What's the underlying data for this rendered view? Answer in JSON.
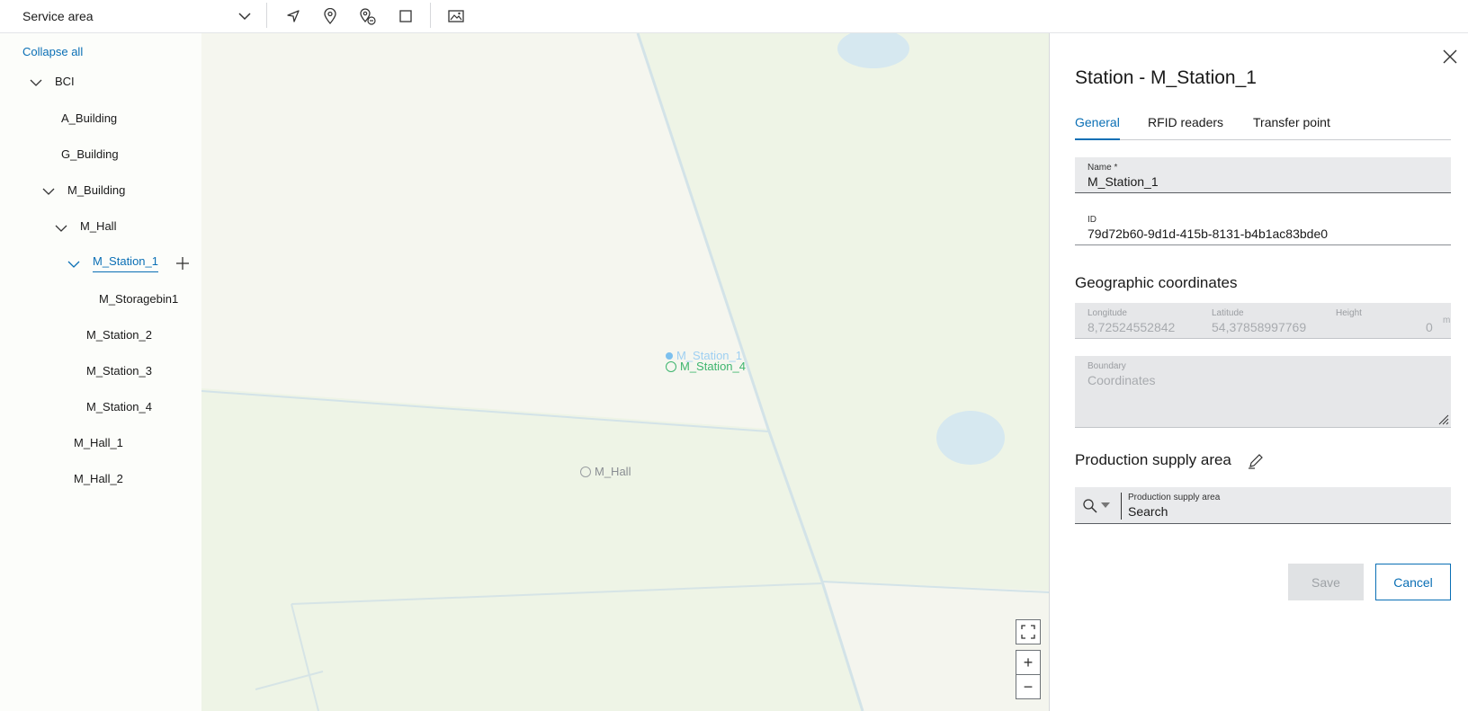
{
  "toolbar": {
    "area_select": "Service area",
    "tools": [
      "navigate-icon",
      "pin-icon",
      "pin-remove-icon",
      "rectangle-icon",
      "image-icon"
    ]
  },
  "tree": {
    "collapse_all": "Collapse all",
    "nodes": [
      "BCI",
      "A_Building",
      "G_Building",
      "M_Building",
      "M_Hall",
      "M_Station_1",
      "M_Storagebin1",
      "M_Station_2",
      "M_Station_3",
      "M_Station_4",
      "M_Hall_1",
      "M_Hall_2"
    ],
    "selected": "M_Station_1"
  },
  "map": {
    "markers": [
      "M_Station_1",
      "M_Station_4",
      "M_Hall"
    ],
    "controls": [
      "fullscreen-icon",
      "+",
      "−"
    ]
  },
  "panel": {
    "title": "Station - M_Station_1",
    "tabs": [
      "General",
      "RFID readers",
      "Transfer point"
    ],
    "active_tab": "General",
    "name_label": "Name *",
    "name_value": "M_Station_1",
    "id_label": "ID",
    "id_value": "79d72b60-9d1d-415b-8131-b4b1ac83bde0",
    "geo_heading": "Geographic coordinates",
    "longitude_label": "Longitude",
    "longitude_value": "8,72524552842",
    "latitude_label": "Latitude",
    "latitude_value": "54,37858997769",
    "height_label": "Height",
    "height_value": "0",
    "height_unit": "m",
    "boundary_label": "Boundary",
    "boundary_placeholder": "Coordinates",
    "psa_heading": "Production supply area",
    "psa_label": "Production supply area",
    "psa_value": "Search",
    "save": "Save",
    "cancel": "Cancel"
  },
  "colors": {
    "accent": "#0a6fb5",
    "marker_blue": "#7cc0ee",
    "marker_green": "#3eb56e"
  }
}
